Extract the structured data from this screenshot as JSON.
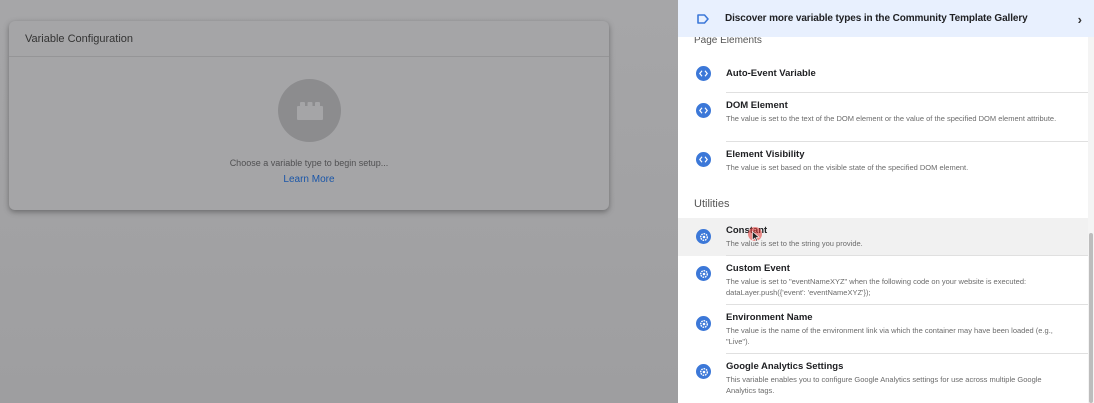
{
  "left": {
    "card_title": "Variable Configuration",
    "hint": "Choose a variable type to begin setup...",
    "learn_more": "Learn More"
  },
  "panel": {
    "banner_text": "Discover more variable types in the Community Template Gallery",
    "banner_chevron": "›",
    "partial_section": "Page Elements",
    "page_elements": [
      {
        "title": "Auto-Event Variable",
        "desc": ""
      },
      {
        "title": "DOM Element",
        "desc": "The value is set to the text of the DOM element or the value of the specified DOM element attribute."
      },
      {
        "title": "Element Visibility",
        "desc": "The value is set based on the visible state of the specified DOM element."
      }
    ],
    "utilities_heading": "Utilities",
    "utilities": [
      {
        "title": "Constant",
        "desc": "The value is set to the string you provide."
      },
      {
        "title": "Custom Event",
        "desc": "The value is set to \"eventNameXYZ\" when the following code on your website is executed: dataLayer.push({'event': 'eventNameXYZ'});"
      },
      {
        "title": "Environment Name",
        "desc": "The value is the name of the environment link via which the container may have been loaded (e.g., \"Live\")."
      },
      {
        "title": "Google Analytics Settings",
        "desc": "This variable enables you to configure Google Analytics settings for use across multiple Google Analytics tags."
      }
    ]
  },
  "colors": {
    "accent": "#3c78d8",
    "banner_bg": "#e8f0fe",
    "link": "#1a56a8",
    "cursor": "#e53935"
  },
  "icons": {
    "banner": "tag-outline-icon",
    "page_element": "code-brackets-icon",
    "utility": "gear-icon",
    "placeholder": "brick-icon"
  }
}
